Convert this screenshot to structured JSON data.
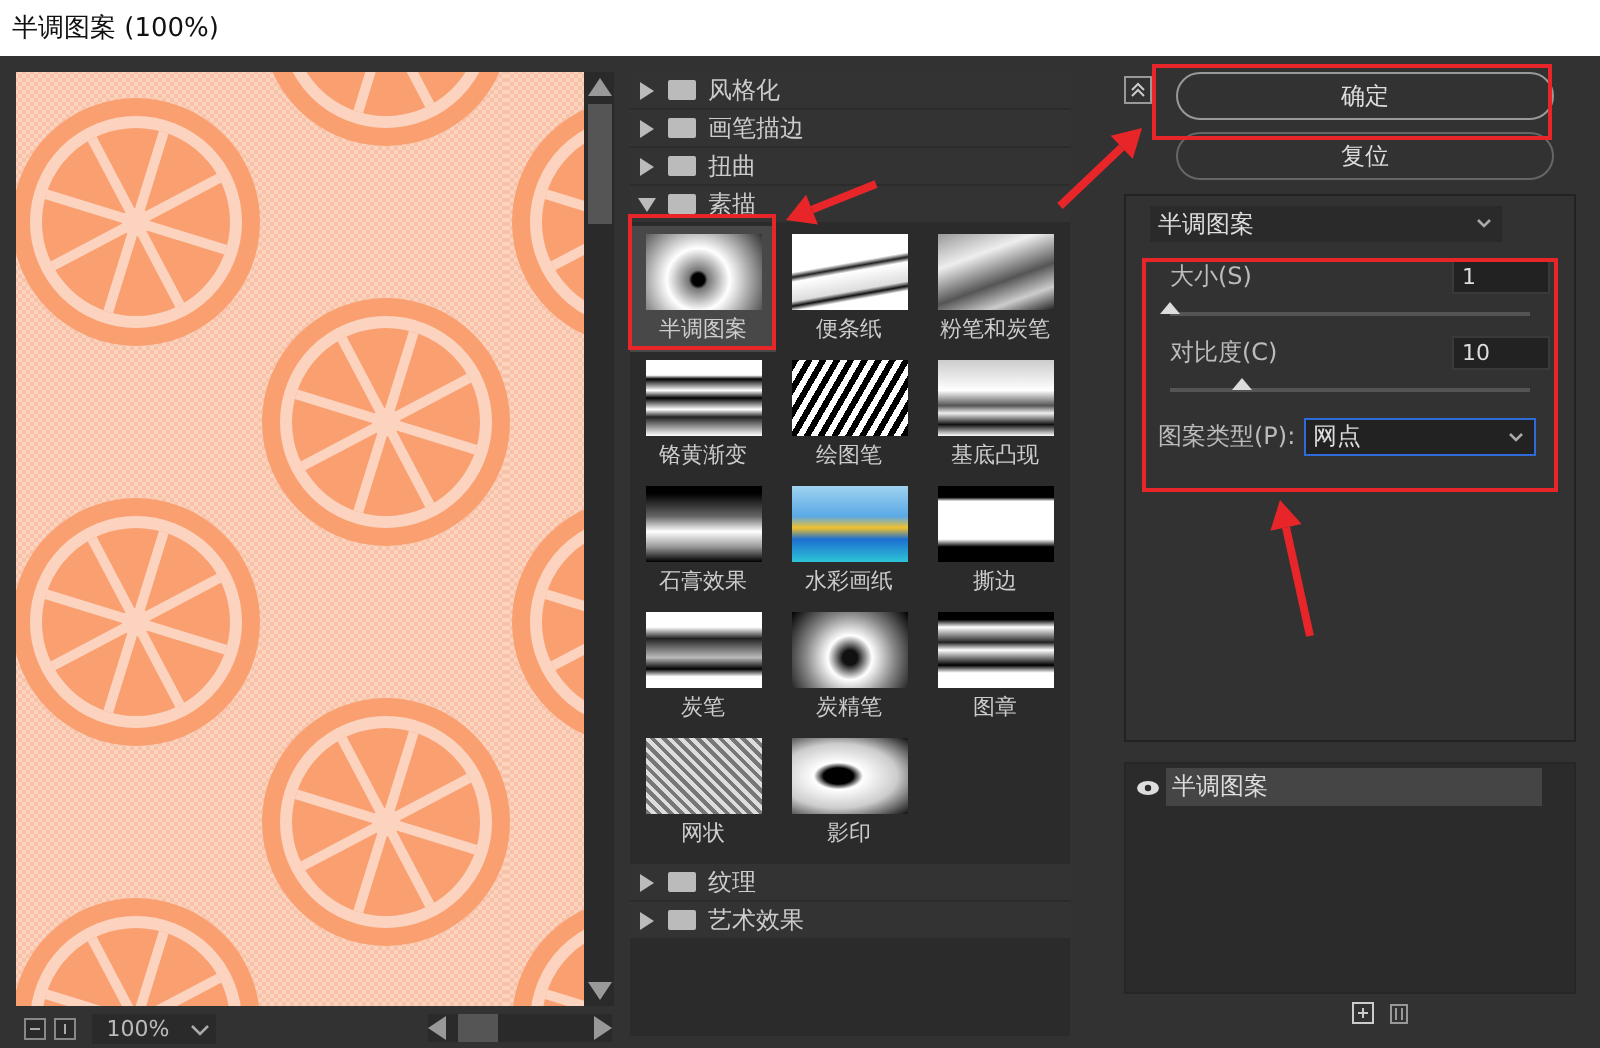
{
  "window": {
    "title": "半调图案 (100%)"
  },
  "preview": {
    "zoom": "100%"
  },
  "filter_gallery": {
    "categories": [
      {
        "label": "风格化",
        "expanded": false
      },
      {
        "label": "画笔描边",
        "expanded": false
      },
      {
        "label": "扭曲",
        "expanded": false
      },
      {
        "label": "素描",
        "expanded": true,
        "filters": [
          {
            "label": "半调图案",
            "selected": true
          },
          {
            "label": "便条纸",
            "selected": false
          },
          {
            "label": "粉笔和炭笔",
            "selected": false
          },
          {
            "label": "铬黄渐变",
            "selected": false
          },
          {
            "label": "绘图笔",
            "selected": false
          },
          {
            "label": "基底凸现",
            "selected": false
          },
          {
            "label": "石膏效果",
            "selected": false
          },
          {
            "label": "水彩画纸",
            "selected": false
          },
          {
            "label": "撕边",
            "selected": false
          },
          {
            "label": "炭笔",
            "selected": false
          },
          {
            "label": "炭精笔",
            "selected": false
          },
          {
            "label": "图章",
            "selected": false
          },
          {
            "label": "网状",
            "selected": false
          },
          {
            "label": "影印",
            "selected": false
          }
        ]
      },
      {
        "label": "纹理",
        "expanded": false
      },
      {
        "label": "艺术效果",
        "expanded": false
      }
    ]
  },
  "buttons": [
    {
      "label": "确定"
    },
    {
      "label": "复位"
    }
  ],
  "settings": {
    "filter": "半调图案",
    "controls": [
      {
        "kind": "slider",
        "label": "大小(S)",
        "value": "1",
        "level": 0.0
      },
      {
        "kind": "slider",
        "label": "对比度(C)",
        "value": "10",
        "level": 0.2
      },
      {
        "kind": "select",
        "label": "图案类型(P):",
        "value": "网点"
      }
    ]
  },
  "layers": [
    {
      "label": "半调图案",
      "visible": true
    }
  ]
}
